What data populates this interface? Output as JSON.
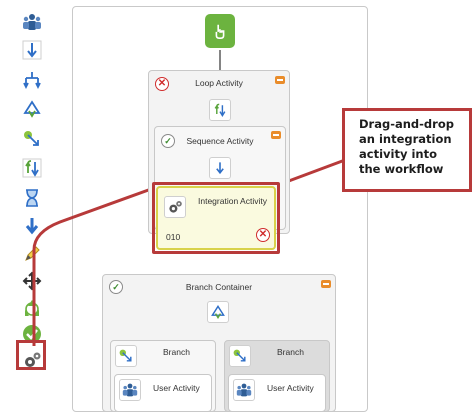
{
  "toolbox": {
    "items": [
      {
        "icon": "user-activity-icon"
      },
      {
        "icon": "sequence-arrow-icon"
      },
      {
        "icon": "branch-split-icon"
      },
      {
        "icon": "branch-container-icon"
      },
      {
        "icon": "condition-arrow-icon"
      },
      {
        "icon": "loop-icon"
      },
      {
        "icon": "hourglass-icon"
      },
      {
        "icon": "download-arrow-icon"
      },
      {
        "icon": "pencil-icon"
      },
      {
        "icon": "move-cross-icon"
      },
      {
        "icon": "recycle-icon"
      },
      {
        "icon": "green-check-icon"
      },
      {
        "icon": "integration-gear-icon"
      }
    ]
  },
  "workflow": {
    "loop_title": "Loop Activity",
    "sequence_title": "Sequence Activity",
    "integration_title": "Integration Activity",
    "integration_id": "010",
    "branch_container_title": "Branch Container",
    "branch_left_title": "Branch",
    "branch_right_title": "Branch",
    "user_activity_left": "User Activity",
    "user_activity_right": "User Activity"
  },
  "callout": {
    "line1": "Drag-and-drop",
    "line2": "an integration",
    "line3": "activity into",
    "line4": "the workflow"
  },
  "colors": {
    "highlight_red": "#b73a3a",
    "integration_yellow": "#d8d24a",
    "start_green": "#6cb33f"
  }
}
